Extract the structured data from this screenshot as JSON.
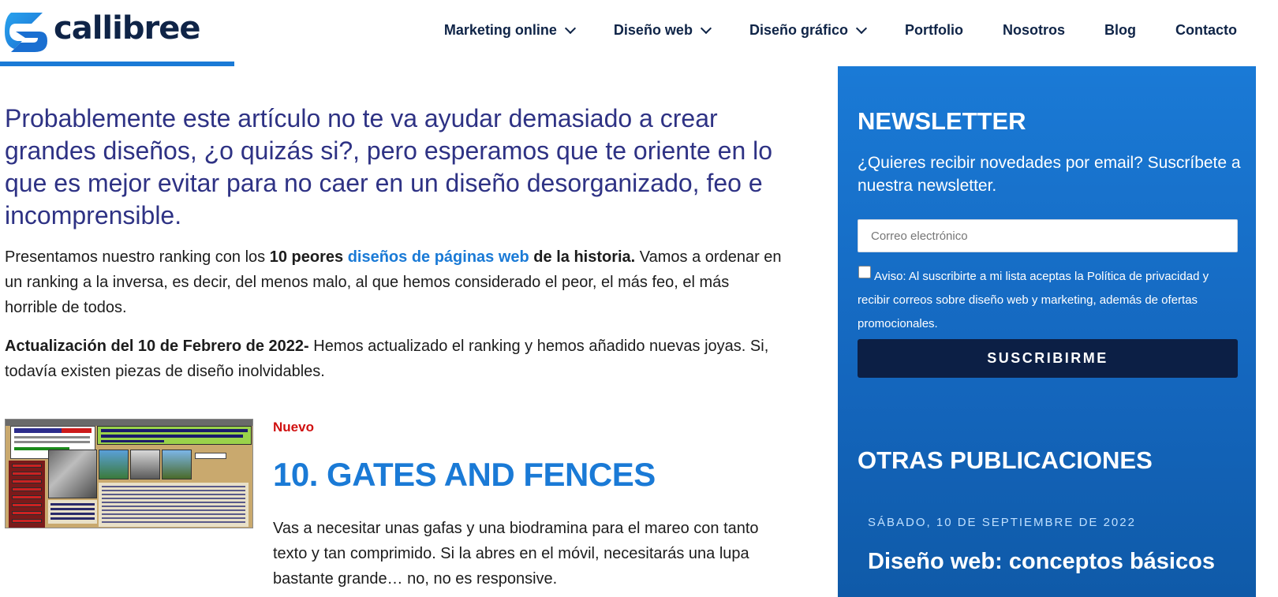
{
  "header": {
    "logo_text": "callibree",
    "nav": [
      {
        "label": "Marketing online",
        "dropdown": true
      },
      {
        "label": "Diseño web",
        "dropdown": true
      },
      {
        "label": "Diseño gráfico",
        "dropdown": true
      },
      {
        "label": "Portfolio",
        "dropdown": false
      },
      {
        "label": "Nosotros",
        "dropdown": false
      },
      {
        "label": "Blog",
        "dropdown": false
      },
      {
        "label": "Contacto",
        "dropdown": false
      }
    ]
  },
  "article": {
    "lead": "Probablemente este artículo no te va ayudar demasiado a crear grandes diseños, ¿o quizás si?, pero esperamos que te oriente en lo que es mejor evitar para no caer en un diseño desorganizado, feo e incomprensible.",
    "intro_part1": "Presentamos nuestro ranking con los ",
    "intro_bold1": "10 peores",
    "intro_space": " ",
    "intro_link": "diseños de páginas web",
    "intro_bold2": " de la historia.",
    "intro_rest": " Vamos a ordenar en un ranking a la inversa, es decir, del menos malo, al que hemos considerado el peor, el más feo, el más horrible de todos.",
    "update_bold": "Actualización del 10 de Febrero de 2022-",
    "update_rest": " Hemos actualizado el ranking y hemos añadido nuevas joyas. Si, todavía existen piezas de diseño inolvidables.",
    "entry": {
      "badge": "Nuevo",
      "title": "10. GATES AND FENCES",
      "body": "Vas a necesitar unas gafas y una biodramina para el mareo con tanto texto y tan comprimido. Si la abres en el móvil, necesitarás una lupa bastante grande… no, no es responsive."
    }
  },
  "sidebar": {
    "newsletter_title": "NEWSLETTER",
    "newsletter_sub": "¿Quieres recibir novedades por email? Suscríbete a nuestra newsletter.",
    "email_placeholder": "Correo electrónico",
    "terms": "Aviso: Al suscribirte a mi lista aceptas la Política de privacidad y recibir correos sobre diseño web y marketing, además de ofertas promocionales.",
    "button": "SUSCRIBIRME",
    "other_title": "OTRAS PUBLICACIONES",
    "post_date": "SÁBADO, 10 DE SEPTIEMBRE DE 2022",
    "post_title": "Diseño web: conceptos básicos"
  },
  "colors": {
    "brand_navy": "#0f2447",
    "brand_blue": "#1a7ad6",
    "lead_text": "#2e3284",
    "badge_red": "#d01010",
    "button_dark": "#0c1f45"
  },
  "icons": [
    "callibree-logo-icon",
    "chevron-down-icon"
  ]
}
